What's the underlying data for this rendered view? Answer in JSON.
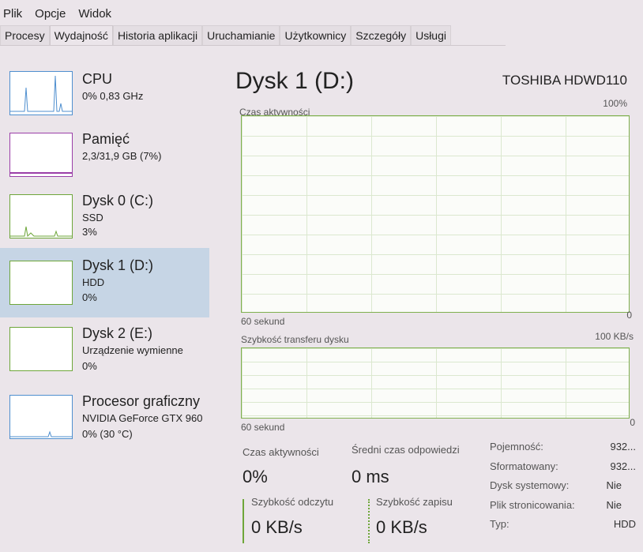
{
  "menu": [
    "Plik",
    "Opcje",
    "Widok"
  ],
  "tabs": [
    "Procesy",
    "Wydajność",
    "Historia aplikacji",
    "Uruchamianie",
    "Użytkownicy",
    "Szczegóły",
    "Usługi"
  ],
  "sidebar": [
    {
      "name": "CPU",
      "sub1": "0% 0,83 GHz",
      "sub2": ""
    },
    {
      "name": "Pamięć",
      "sub1": "2,3/31,9 GB (7%)",
      "sub2": ""
    },
    {
      "name": "Dysk 0 (C:)",
      "sub1": "SSD",
      "sub2": "3%"
    },
    {
      "name": "Dysk 1 (D:)",
      "sub1": "HDD",
      "sub2": "0%"
    },
    {
      "name": "Dysk 2 (E:)",
      "sub1": "Urządzenie wymienne",
      "sub2": "0%"
    },
    {
      "name": "Procesor graficzny",
      "sub1": "NVIDIA GeForce GTX 960",
      "sub2": "0% (30 °C)"
    }
  ],
  "main": {
    "title": "Dysk 1 (D:)",
    "model": "TOSHIBA HDWD110",
    "graph1": {
      "label": "Czas aktywności",
      "max": "100%",
      "min": "0",
      "time": "60 sekund"
    },
    "graph2": {
      "label": "Szybkość transferu dysku",
      "max": "100 KB/s",
      "min": "0",
      "time": "60 sekund"
    },
    "stats": {
      "active_label": "Czas aktywności",
      "active": "0%",
      "resp_label": "Średni czas odpowiedzi",
      "resp": "0 ms",
      "read_label": "Szybkość odczytu",
      "read": "0 KB/s",
      "write_label": "Szybkość zapisu",
      "write": "0 KB/s"
    },
    "props": [
      [
        "Pojemność:",
        "932..."
      ],
      [
        "Sformatowany:",
        "932..."
      ],
      [
        "Dysk systemowy:",
        "Nie"
      ],
      [
        "Plik stronicowania:",
        "Nie"
      ],
      [
        "Typ:",
        "HDD"
      ]
    ]
  },
  "colors": {
    "cpu": "#4f8fcf",
    "mem": "#9b3fa8",
    "disk": "#6ea63a",
    "selected": "#c6d5e5"
  }
}
